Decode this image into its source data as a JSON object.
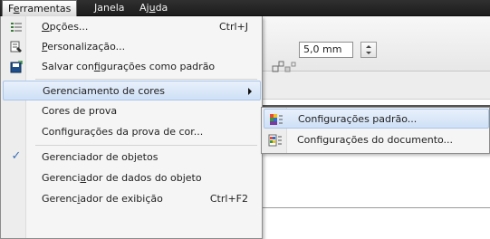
{
  "menubar": {
    "items": [
      {
        "label": "Ferramentas",
        "underline": "e",
        "active": true
      },
      {
        "label": "Janela",
        "underline": "J"
      },
      {
        "label": "Ajuda",
        "underline": "u"
      }
    ]
  },
  "toolbar": {
    "size_value": "5,0 mm"
  },
  "menu": {
    "items": [
      {
        "label": "Opções...",
        "shortcut": "Ctrl+J",
        "icon": "options-icon"
      },
      {
        "label": "Personalização...",
        "icon": "customize-icon"
      },
      {
        "label": "Salvar configurações como padrão",
        "icon": "save-icon"
      },
      {
        "label": "Gerenciamento de cores",
        "submenu": true,
        "highlighted": true
      },
      {
        "label": "Cores de prova"
      },
      {
        "label": "Configurações da prova de cor..."
      },
      {
        "label": "Gerenciador de objetos",
        "checked": true
      },
      {
        "label": "Gerenciador de dados do objeto"
      },
      {
        "label": "Gerenciador de exibição",
        "shortcut": "Ctrl+F2"
      }
    ]
  },
  "submenu": {
    "items": [
      {
        "label": "Configurações padrão...",
        "icon": "color-settings-icon",
        "highlighted": true
      },
      {
        "label": "Configurações do documento...",
        "icon": "document-color-icon"
      }
    ]
  },
  "colors": {
    "menubar_bg": "#262626",
    "menu_bg": "#f5f5f5",
    "highlight_bg": "#cfe0f6",
    "highlight_border": "#a9c5ea",
    "check_color": "#3a6fb8"
  }
}
